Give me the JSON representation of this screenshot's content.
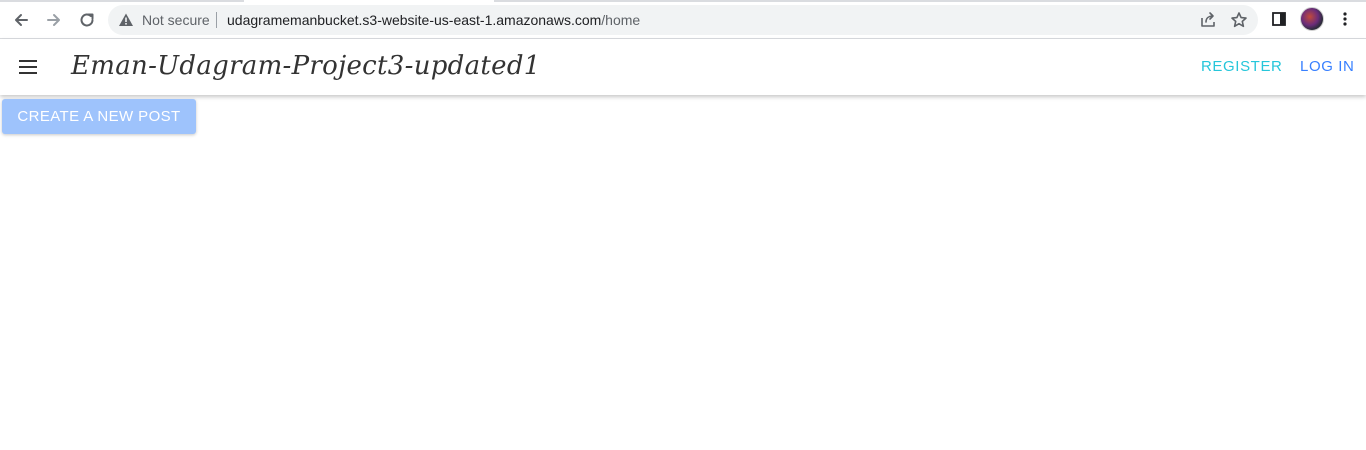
{
  "browser": {
    "security_label": "Not secure",
    "url_host": "udagramemanbucket.s3-website-us-east-1.amazonaws.com",
    "url_path": "/home",
    "icons": [
      "back-icon",
      "forward-icon",
      "reload-icon",
      "warning-icon",
      "share-icon",
      "star-icon",
      "side-panel-icon",
      "profile-avatar",
      "more-menu-icon"
    ]
  },
  "app": {
    "title": "Eman-Udagram-Project3-updated1",
    "nav": {
      "register": "REGISTER",
      "login": "LOG IN"
    },
    "create_post_label": "CREATE A NEW POST"
  },
  "colors": {
    "register": "#26c6da",
    "login": "#3880ff",
    "create_button_bg": "#9ec3fc"
  }
}
